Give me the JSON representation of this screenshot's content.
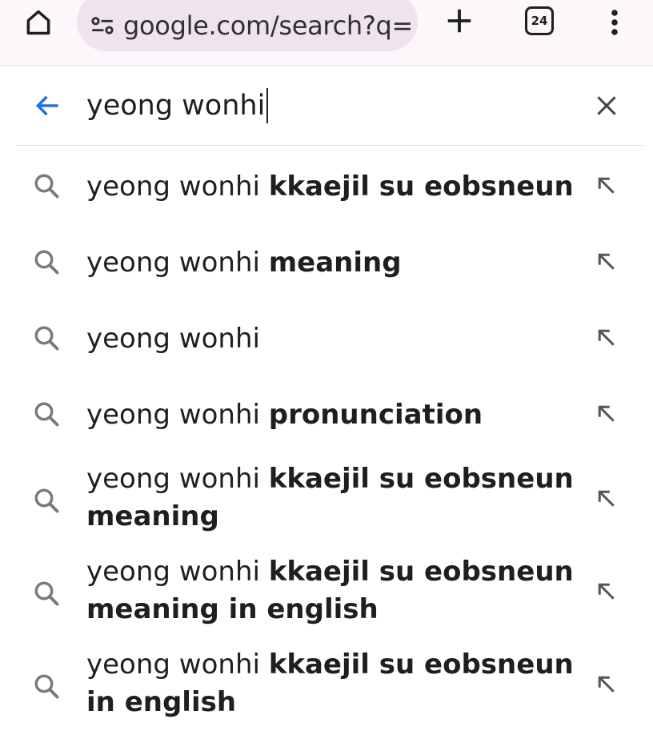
{
  "toolbar": {
    "home_icon": "home-icon",
    "url": "google.com/search?q=",
    "site_settings_icon": "tune-icon",
    "new_tab_icon": "plus-icon",
    "tab_count": "24",
    "menu_icon": "more-vert-icon"
  },
  "search": {
    "query": "yeong wonhi",
    "back_icon": "arrow-back-icon",
    "clear_icon": "close-icon",
    "accent_color": "#1a73e8"
  },
  "suggestions": [
    {
      "prefix": "yeong wonhi",
      "completion": "kkaejil su eobsneun"
    },
    {
      "prefix": "yeong wonhi",
      "completion": "meaning"
    },
    {
      "prefix": "yeong wonhi",
      "completion": ""
    },
    {
      "prefix": "yeong wonhi",
      "completion": "pronunciation"
    },
    {
      "prefix": "yeong wonhi",
      "completion": "kkaejil su eobsneun meaning"
    },
    {
      "prefix": "yeong wonhi",
      "completion": "kkaejil su eobsneun meaning in english"
    },
    {
      "prefix": "yeong wonhi",
      "completion": "kkaejil su eobsneun in english"
    }
  ]
}
